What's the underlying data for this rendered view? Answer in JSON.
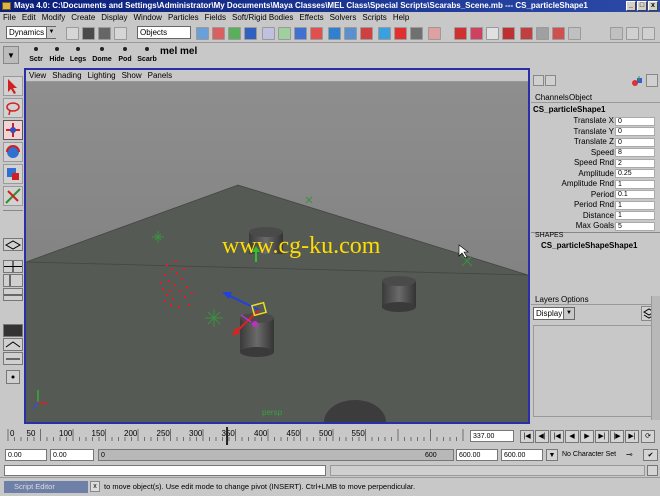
{
  "window": {
    "title": "Maya 4.0: C:\\Documents and Settings\\Administrator\\My Documents\\Maya Classes\\MEL Class\\Special Scripts\\Scarabs_Scene.mb  ---  CS_particleShape1",
    "minimize": "_",
    "maximize": "□",
    "close": "x"
  },
  "menubar": [
    "File",
    "Edit",
    "Modify",
    "Create",
    "Display",
    "Window",
    "Particles",
    "Fields",
    "Soft/Rigid Bodies",
    "Effects",
    "Solvers",
    "Scripts",
    "Help"
  ],
  "statusline": {
    "mode": "Dynamics",
    "object_field": "Objects"
  },
  "shelf": {
    "buttons": [
      "Sctr",
      "Hide",
      "Legs",
      "Dome",
      "Pod",
      "Scarb"
    ],
    "mel_buttons": [
      "mel",
      "mel"
    ]
  },
  "viewport": {
    "menu": [
      "View",
      "Shading",
      "Lighting",
      "Show",
      "Panels"
    ],
    "camera": "persp",
    "watermark": "www.cg-ku.com"
  },
  "channelbox": {
    "tabs": [
      "Channels",
      "Object"
    ],
    "node": "CS_particleShape1",
    "attributes": [
      {
        "name": "Translate X",
        "value": "0"
      },
      {
        "name": "Translate Y",
        "value": "0"
      },
      {
        "name": "Translate Z",
        "value": "0"
      },
      {
        "name": "Speed",
        "value": "8"
      },
      {
        "name": "Speed Rnd",
        "value": "2"
      },
      {
        "name": "Amplitude",
        "value": "0.25"
      },
      {
        "name": "Amplitude Rnd",
        "value": "1"
      },
      {
        "name": "Period",
        "value": "0.1"
      },
      {
        "name": "Period Rnd",
        "value": "1"
      },
      {
        "name": "Distance",
        "value": "1"
      },
      {
        "name": "Max Goals",
        "value": "5"
      }
    ],
    "shapes_header": "SHAPES",
    "shape_node": "CS_particleShapeShape1"
  },
  "layers": {
    "tabs": [
      "Layers",
      "Options"
    ],
    "dropdown": "Display"
  },
  "timeline": {
    "ticks": [
      "50",
      "100",
      "150",
      "200",
      "250",
      "300",
      "350",
      "400",
      "450",
      "500",
      "550"
    ],
    "first_tick": "0",
    "current_frame": "337.00"
  },
  "range": {
    "start": "0.00",
    "playback_start": "0.00",
    "slider_start": "0",
    "slider_end": "600",
    "playback_end": "600.00",
    "end": "600.00",
    "character": "No Character Set"
  },
  "helpline": {
    "tab": "Script Editor",
    "text": "to move object(s). Use edit mode to change pivot (INSERT).  Ctrl+LMB to move perpendicular."
  },
  "colors": {
    "title_bg": "#0a1e7a",
    "viewport_border": "#2a2fa8",
    "floor": "#555a55",
    "sky": "#8c8c8c",
    "watermark": "#ffdd00"
  }
}
